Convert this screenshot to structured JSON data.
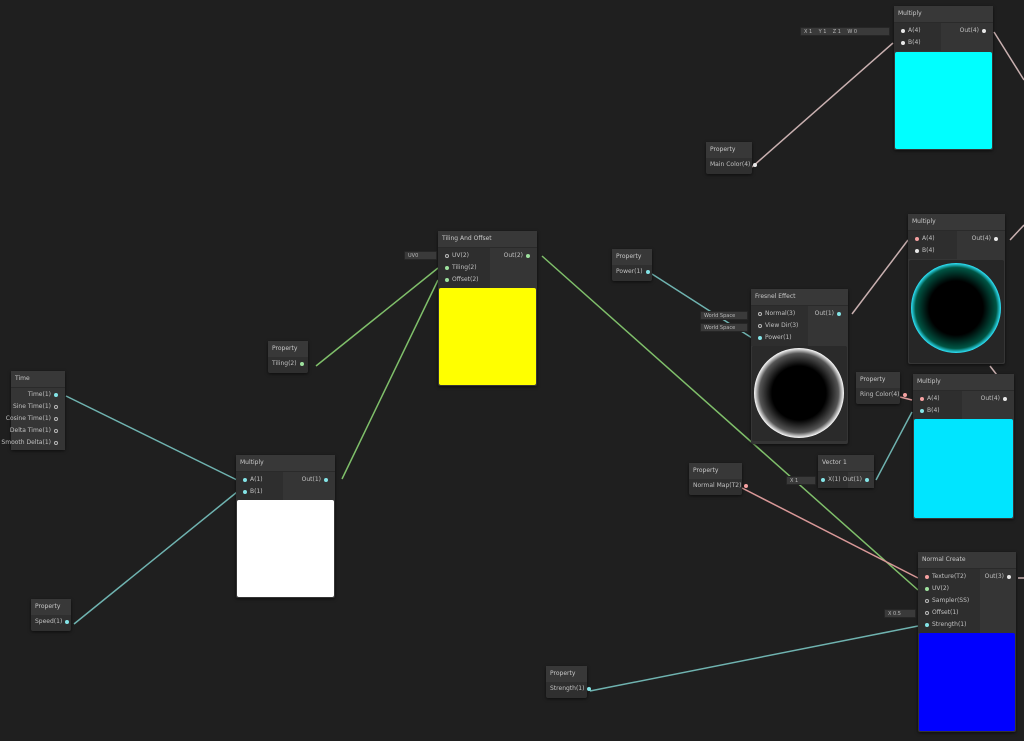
{
  "nodes": {
    "multiply_top": {
      "title": "Multiply",
      "in_a": "A(4)",
      "in_b": "B(4)",
      "out": "Out(4)",
      "vec_x": "X 1",
      "vec_y": "Y 1",
      "vec_z": "Z 1",
      "vec_w": "W 0",
      "preview_color": "#00ffff"
    },
    "property_main_color": {
      "title": "Property",
      "row": "Main Color(4)"
    },
    "tiling_offset": {
      "title": "Tiling And Offset",
      "in_uv": "UV(2)",
      "in_tiling": "Tiling(2)",
      "in_offset": "Offset(2)",
      "out": "Out(2)",
      "uv_field": "UV0",
      "preview_color": "#ffff00"
    },
    "property_tiling": {
      "title": "Property",
      "row": "Tiling(2)"
    },
    "property_power": {
      "title": "Property",
      "row": "Power(1)"
    },
    "fresnel": {
      "title": "Fresnel Effect",
      "in_normal": "Normal(3)",
      "in_view": "View Dir(3)",
      "in_power": "Power(1)",
      "out": "Out(1)",
      "field_normal": "World Space",
      "field_view": "World Space"
    },
    "multiply_mid": {
      "title": "Multiply",
      "in_a": "A(4)",
      "in_b": "B(4)",
      "out": "Out(4)"
    },
    "property_ring_color": {
      "title": "Property",
      "row": "Ring Color(4)"
    },
    "multiply_ring": {
      "title": "Multiply",
      "in_a": "A(4)",
      "in_b": "B(4)",
      "out": "Out(4)",
      "preview_color": "#00e5ff"
    },
    "time": {
      "title": "Time",
      "rows": [
        "Time(1)",
        "Sine Time(1)",
        "Cosine Time(1)",
        "Delta Time(1)",
        "Smooth Delta(1)"
      ]
    },
    "multiply_speed": {
      "title": "Multiply",
      "in_a": "A(1)",
      "in_b": "B(1)",
      "out": "Out(1)",
      "preview_color": "#ffffff"
    },
    "property_speed": {
      "title": "Property",
      "row": "Speed(1)"
    },
    "property_normal_map": {
      "title": "Property",
      "row": "Normal Map(T2)"
    },
    "vector1": {
      "title": "Vector 1",
      "in_x": "X(1)",
      "out": "Out(1)",
      "field": "X 1"
    },
    "normal_create": {
      "title": "Normal Create",
      "in_texture": "Texture(T2)",
      "in_uv": "UV(2)",
      "in_sampler": "Sampler(SS)",
      "in_offset": "Offset(1)",
      "in_strength": "Strength(1)",
      "out": "Out(3)",
      "offset_field": "X 0.5",
      "preview_color": "#0000ff"
    },
    "property_strength": {
      "title": "Property",
      "row": "Strength(1)"
    }
  },
  "colors": {
    "background": "#1f1f1f",
    "wire_green": "#7fbf6a",
    "wire_teal": "#6fb3b0",
    "wire_pink": "#d99898",
    "wire_pink_light": "#c9b0b0"
  }
}
